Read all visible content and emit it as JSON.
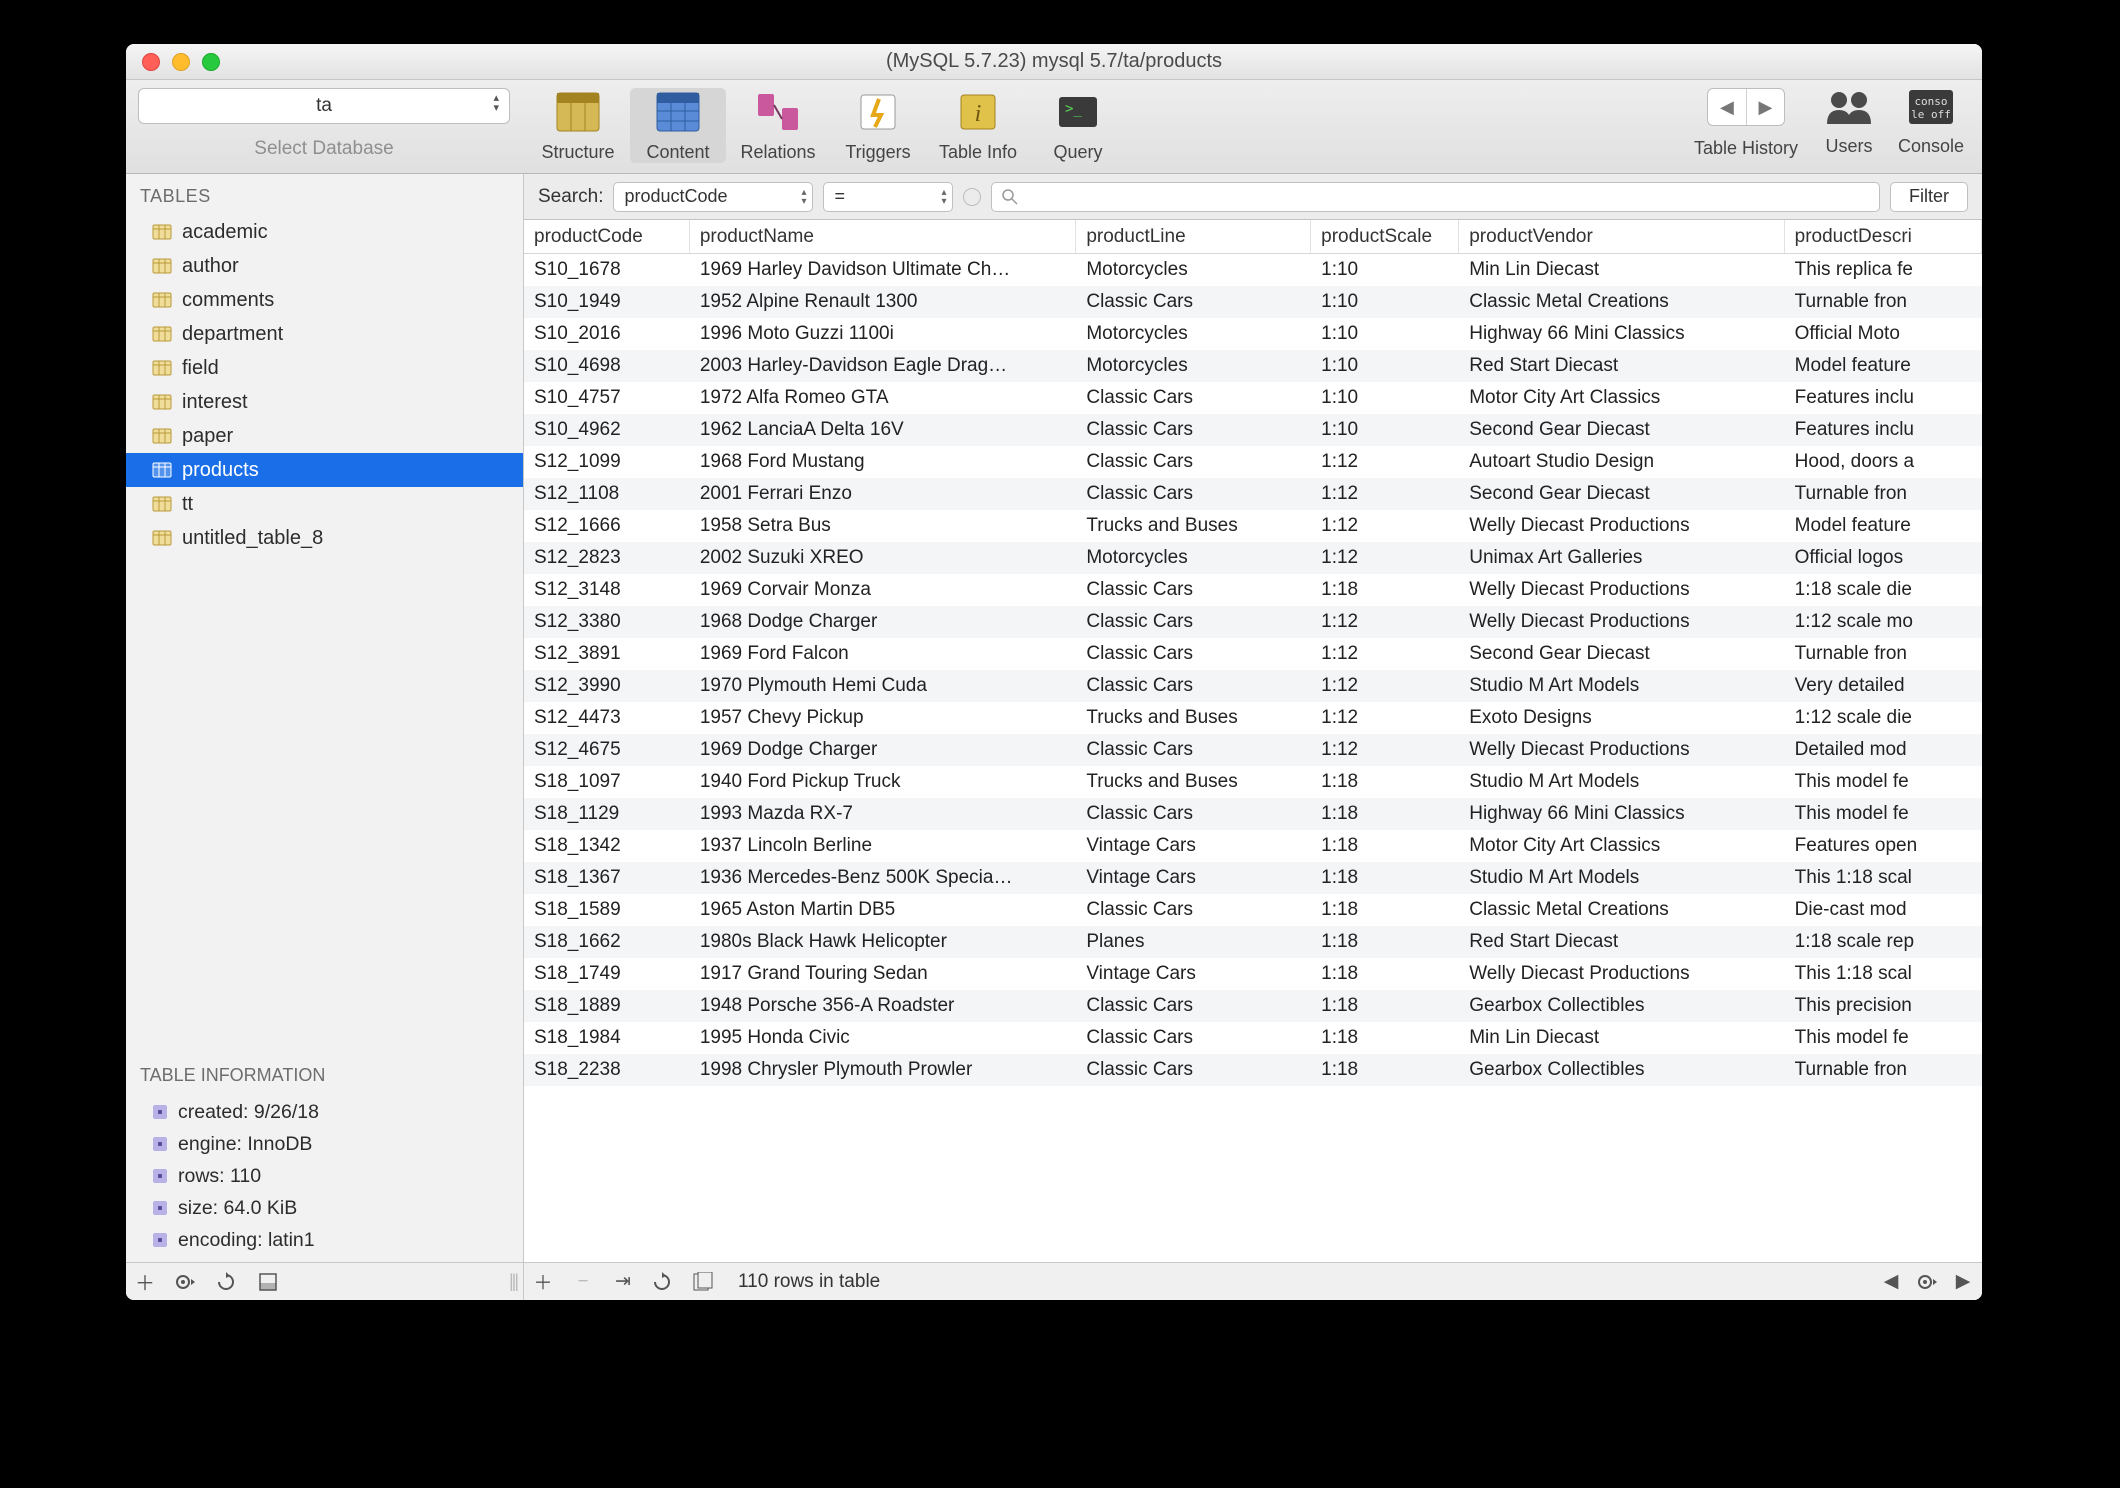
{
  "window": {
    "title": "(MySQL 5.7.23) mysql 5.7/ta/products"
  },
  "db_selector": {
    "value": "ta",
    "caption": "Select Database"
  },
  "toolbar": {
    "structure": "Structure",
    "content": "Content",
    "relations": "Relations",
    "triggers": "Triggers",
    "tableinfo": "Table Info",
    "query": "Query",
    "history": "Table History",
    "users": "Users",
    "console": "Console"
  },
  "sidebar": {
    "header": "TABLES",
    "tables": [
      "academic",
      "author",
      "comments",
      "department",
      "field",
      "interest",
      "paper",
      "products",
      "tt",
      "untitled_table_8"
    ],
    "selected": "products",
    "info_header": "TABLE INFORMATION",
    "info": {
      "created": "created: 9/26/18",
      "engine": "engine: InnoDB",
      "rows": "rows: 110",
      "size": "size: 64.0 KiB",
      "encoding": "encoding: latin1"
    }
  },
  "search": {
    "label": "Search:",
    "column": "productCode",
    "op": "=",
    "filter_btn": "Filter"
  },
  "columns": [
    "productCode",
    "productName",
    "productLine",
    "productScale",
    "productVendor",
    "productDescri"
  ],
  "rows": [
    [
      "S10_1678",
      "1969 Harley Davidson Ultimate Ch…",
      "Motorcycles",
      "1:10",
      "Min Lin Diecast",
      "This replica fe"
    ],
    [
      "S10_1949",
      "1952 Alpine Renault 1300",
      "Classic Cars",
      "1:10",
      "Classic Metal Creations",
      "Turnable fron"
    ],
    [
      "S10_2016",
      "1996 Moto Guzzi 1100i",
      "Motorcycles",
      "1:10",
      "Highway 66 Mini Classics",
      "Official Moto"
    ],
    [
      "S10_4698",
      "2003 Harley-Davidson Eagle Drag…",
      "Motorcycles",
      "1:10",
      "Red Start Diecast",
      "Model feature"
    ],
    [
      "S10_4757",
      "1972 Alfa Romeo GTA",
      "Classic Cars",
      "1:10",
      "Motor City Art Classics",
      "Features inclu"
    ],
    [
      "S10_4962",
      "1962 LanciaA Delta 16V",
      "Classic Cars",
      "1:10",
      "Second Gear Diecast",
      "Features inclu"
    ],
    [
      "S12_1099",
      "1968 Ford Mustang",
      "Classic Cars",
      "1:12",
      "Autoart Studio Design",
      "Hood, doors a"
    ],
    [
      "S12_1108",
      "2001 Ferrari Enzo",
      "Classic Cars",
      "1:12",
      "Second Gear Diecast",
      "Turnable fron"
    ],
    [
      "S12_1666",
      "1958 Setra Bus",
      "Trucks and Buses",
      "1:12",
      "Welly Diecast Productions",
      "Model feature"
    ],
    [
      "S12_2823",
      "2002 Suzuki XREO",
      "Motorcycles",
      "1:12",
      "Unimax Art Galleries",
      "Official logos"
    ],
    [
      "S12_3148",
      "1969 Corvair Monza",
      "Classic Cars",
      "1:18",
      "Welly Diecast Productions",
      "1:18 scale die"
    ],
    [
      "S12_3380",
      "1968 Dodge Charger",
      "Classic Cars",
      "1:12",
      "Welly Diecast Productions",
      "1:12 scale mo"
    ],
    [
      "S12_3891",
      "1969 Ford Falcon",
      "Classic Cars",
      "1:12",
      "Second Gear Diecast",
      "Turnable fron"
    ],
    [
      "S12_3990",
      "1970 Plymouth Hemi Cuda",
      "Classic Cars",
      "1:12",
      "Studio M Art Models",
      "Very detailed"
    ],
    [
      "S12_4473",
      "1957 Chevy Pickup",
      "Trucks and Buses",
      "1:12",
      "Exoto Designs",
      "1:12 scale die"
    ],
    [
      "S12_4675",
      "1969 Dodge Charger",
      "Classic Cars",
      "1:12",
      "Welly Diecast Productions",
      "Detailed mod"
    ],
    [
      "S18_1097",
      "1940 Ford Pickup Truck",
      "Trucks and Buses",
      "1:18",
      "Studio M Art Models",
      "This model fe"
    ],
    [
      "S18_1129",
      "1993 Mazda RX-7",
      "Classic Cars",
      "1:18",
      "Highway 66 Mini Classics",
      "This model fe"
    ],
    [
      "S18_1342",
      "1937 Lincoln Berline",
      "Vintage Cars",
      "1:18",
      "Motor City Art Classics",
      "Features open"
    ],
    [
      "S18_1367",
      "1936 Mercedes-Benz 500K Specia…",
      "Vintage Cars",
      "1:18",
      "Studio M Art Models",
      "This 1:18 scal"
    ],
    [
      "S18_1589",
      "1965 Aston Martin DB5",
      "Classic Cars",
      "1:18",
      "Classic Metal Creations",
      "Die-cast mod"
    ],
    [
      "S18_1662",
      "1980s Black Hawk Helicopter",
      "Planes",
      "1:18",
      "Red Start Diecast",
      "1:18 scale rep"
    ],
    [
      "S18_1749",
      "1917 Grand Touring Sedan",
      "Vintage Cars",
      "1:18",
      "Welly Diecast Productions",
      "This 1:18 scal"
    ],
    [
      "S18_1889",
      "1948 Porsche 356-A Roadster",
      "Classic Cars",
      "1:18",
      "Gearbox Collectibles",
      "This precision"
    ],
    [
      "S18_1984",
      "1995 Honda Civic",
      "Classic Cars",
      "1:18",
      "Min Lin Diecast",
      "This model fe"
    ],
    [
      "S18_2238",
      "1998 Chrysler Plymouth Prowler",
      "Classic Cars",
      "1:18",
      "Gearbox Collectibles",
      "Turnable fron"
    ]
  ],
  "footer": {
    "status": "110 rows in table"
  }
}
